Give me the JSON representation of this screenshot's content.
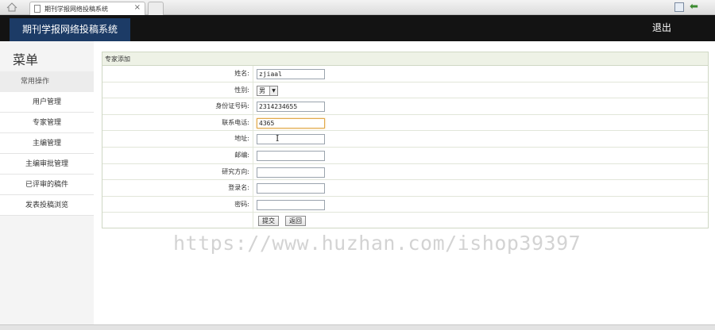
{
  "browser": {
    "tab_title": "期刊学报网络投稿系统",
    "tab_close": "×"
  },
  "header": {
    "app_title": "期刊学报网络投稿系统",
    "logout": "退出"
  },
  "sidebar": {
    "title": "菜单",
    "group": "常用操作",
    "items": [
      {
        "label": "用户管理"
      },
      {
        "label": "专家管理"
      },
      {
        "label": "主编管理"
      },
      {
        "label": "主编审批管理"
      },
      {
        "label": "已评审的稿件"
      },
      {
        "label": "发表投稿浏览"
      }
    ]
  },
  "form": {
    "heading": "专家添加",
    "fields": [
      {
        "label": "姓名:",
        "value": "zjiaal"
      },
      {
        "label": "性别:",
        "value": "男"
      },
      {
        "label": "身份证号码:",
        "value": "2314234655"
      },
      {
        "label": "联系电话:",
        "value": "4365"
      },
      {
        "label": "地址:",
        "value": ""
      },
      {
        "label": "邮编:",
        "value": ""
      },
      {
        "label": "研究方向:",
        "value": ""
      },
      {
        "label": "登录名:",
        "value": ""
      },
      {
        "label": "密码:",
        "value": ""
      }
    ],
    "submit": "提交",
    "back": "返回"
  },
  "watermark": "https://www.huzhan.com/ishop39397"
}
